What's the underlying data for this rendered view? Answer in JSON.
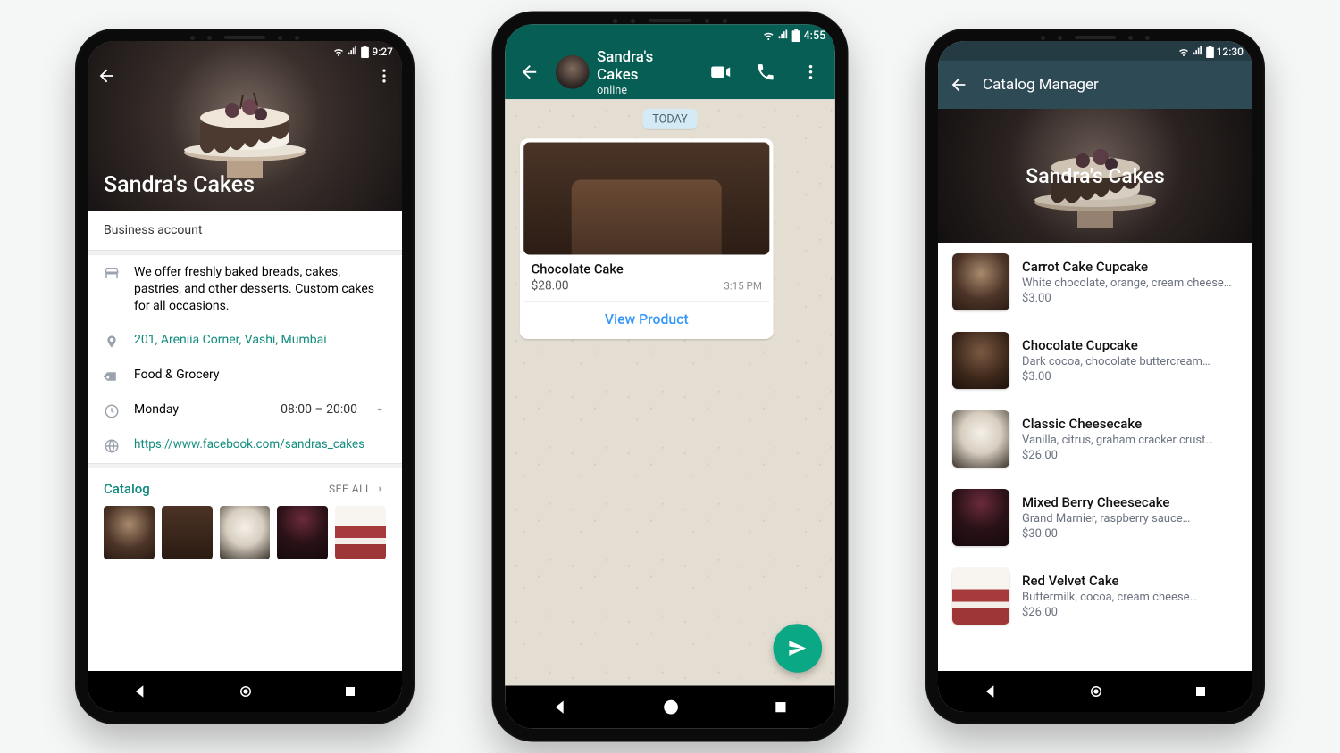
{
  "phone1": {
    "status_time": "9:27",
    "business_name": "Sandra's Cakes",
    "account_label": "Business account",
    "description": "We offer freshly baked breads, cakes, pastries, and other desserts. Custom cakes for all occasions.",
    "address": "201, Areniia Corner, Vashi, Mumbai",
    "category": "Food & Grocery",
    "hours_day": "Monday",
    "hours_times": "08:00 – 20:00",
    "website": "https://www.facebook.com/sandras_cakes",
    "catalog_label": "Catalog",
    "see_all": "SEE ALL"
  },
  "phone2": {
    "status_time": "4:55",
    "chat_name": "Sandra's Cakes",
    "chat_status": "online",
    "day_chip": "TODAY",
    "product_name": "Chocolate Cake",
    "product_price": "$28.00",
    "message_time": "3:15 PM",
    "view_product": "View Product"
  },
  "phone3": {
    "status_time": "12:30",
    "appbar_title": "Catalog Manager",
    "business_name": "Sandra's Cakes",
    "items": [
      {
        "name": "Carrot Cake Cupcake",
        "desc": "White chocolate, orange, cream cheese…",
        "price": "$3.00"
      },
      {
        "name": "Chocolate Cupcake",
        "desc": "Dark cocoa, chocolate buttercream…",
        "price": "$3.00"
      },
      {
        "name": "Classic Cheesecake",
        "desc": "Vanilla, citrus, graham cracker crust…",
        "price": "$26.00"
      },
      {
        "name": "Mixed Berry Cheesecake",
        "desc": "Grand Marnier, raspberry sauce…",
        "price": "$30.00"
      },
      {
        "name": "Red Velvet Cake",
        "desc": "Buttermilk, cocoa, cream cheese…",
        "price": "$26.00"
      }
    ]
  }
}
